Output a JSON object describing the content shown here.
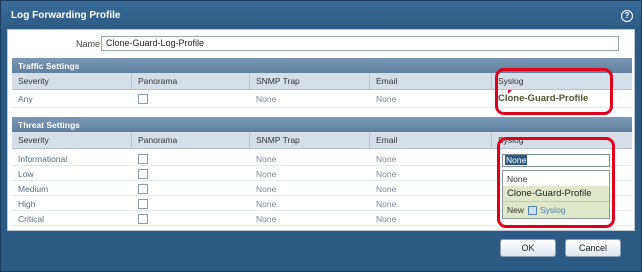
{
  "dialog": {
    "title": "Log Forwarding Profile",
    "help_icon": "question-circle-icon"
  },
  "name_field": {
    "label": "Name",
    "value": "Clone-Guard-Log-Profile"
  },
  "traffic": {
    "section_title": "Traffic Settings",
    "columns": [
      "Severity",
      "Panorama",
      "SNMP Trap",
      "Email",
      "Syslog"
    ],
    "rows": [
      {
        "severity": "Any",
        "panorama": false,
        "snmp": "None",
        "email": "None",
        "syslog": "Clone-Guard-Profile"
      }
    ]
  },
  "threat": {
    "section_title": "Threat Settings",
    "columns": [
      "Severity",
      "Panorama",
      "SNMP Trap",
      "Email",
      "Syslog"
    ],
    "rows": [
      {
        "severity": "Informational",
        "panorama": false,
        "snmp": "None",
        "email": "None",
        "syslog": "None"
      },
      {
        "severity": "Low",
        "panorama": false,
        "snmp": "None",
        "email": "None",
        "syslog": ""
      },
      {
        "severity": "Medium",
        "panorama": false,
        "snmp": "None",
        "email": "None",
        "syslog": ""
      },
      {
        "severity": "High",
        "panorama": false,
        "snmp": "None",
        "email": "None",
        "syslog": ""
      },
      {
        "severity": "Critical",
        "panorama": false,
        "snmp": "None",
        "email": "None",
        "syslog": ""
      }
    ]
  },
  "syslog_dropdown": {
    "current": "None",
    "options": [
      "None",
      "Clone-Guard-Profile"
    ],
    "new_label": "New",
    "new_link": "Syslog"
  },
  "footer": {
    "ok_label": "OK",
    "cancel_label": "Cancel"
  },
  "colors": {
    "title_bar": "#2d5a82",
    "section_header": "#6c8cab",
    "highlight": "#e0001b",
    "selected_option": "#dfe8c8"
  }
}
